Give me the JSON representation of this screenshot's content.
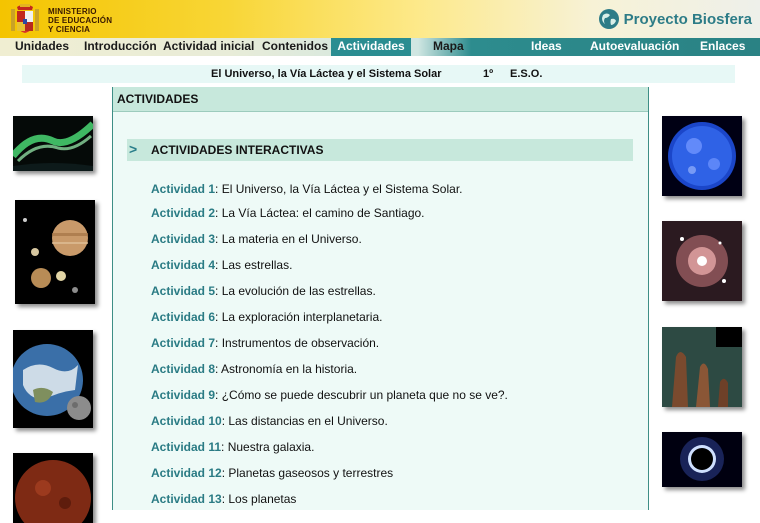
{
  "header": {
    "ministry_lines": [
      "MINISTERIO",
      "DE EDUCACIÓN",
      "Y CIENCIA"
    ],
    "brand": "Proyecto Biosfera"
  },
  "nav": {
    "items": [
      {
        "label": "Unidades"
      },
      {
        "label": "Introducción"
      },
      {
        "label": "Actividad inicial"
      },
      {
        "label": "Contenidos"
      },
      {
        "label": "Actividades"
      },
      {
        "label": "Mapa"
      },
      {
        "label": "Ideas"
      },
      {
        "label": "Autoevaluación"
      },
      {
        "label": "Enlaces"
      }
    ],
    "active": "Actividades"
  },
  "title_bar": {
    "unit_title": "El Universo, la Vía Láctea y el Sistema Solar",
    "course": "1º",
    "level": "E.S.O."
  },
  "main": {
    "section_title": "ACTIVIDADES",
    "subsection_arrow": ">",
    "subsection_title": "ACTIVIDADES INTERACTIVAS",
    "activities": [
      {
        "key": "Actividad 1",
        "text": "El Universo, la Vía Láctea y el Sistema Solar."
      },
      {
        "key": "Actividad 2",
        "text": "La Vía Láctea: el camino de Santiago."
      },
      {
        "key": "Actividad 3",
        "text": "La materia en el Universo."
      },
      {
        "key": "Actividad 4",
        "text": "Las estrellas."
      },
      {
        "key": "Actividad 5",
        "text": "La evolución de las estrellas."
      },
      {
        "key": "Actividad 6",
        "text": "La exploración interplanetaria."
      },
      {
        "key": "Actividad 7",
        "text": "Instrumentos de observación."
      },
      {
        "key": "Actividad 8",
        "text": "Astronomía en la historia."
      },
      {
        "key": "Actividad 9",
        "text": "¿Cómo se puede descubrir un planeta que no se ve?."
      },
      {
        "key": "Actividad 10",
        "text": "Las distancias en el Universo."
      },
      {
        "key": "Actividad 11",
        "text": "Nuestra galaxia."
      },
      {
        "key": "Actividad 12",
        "text": "Planetas gaseosos y terrestres"
      },
      {
        "key": "Actividad 13",
        "text": "Los planetas"
      }
    ]
  },
  "colors": {
    "accent_teal": "#2a8d91",
    "activity_key": "#2a7b84",
    "panel_bg": "#eefaf7",
    "section_bar": "#c7e8dc",
    "header_yellow": "#f4c400"
  }
}
